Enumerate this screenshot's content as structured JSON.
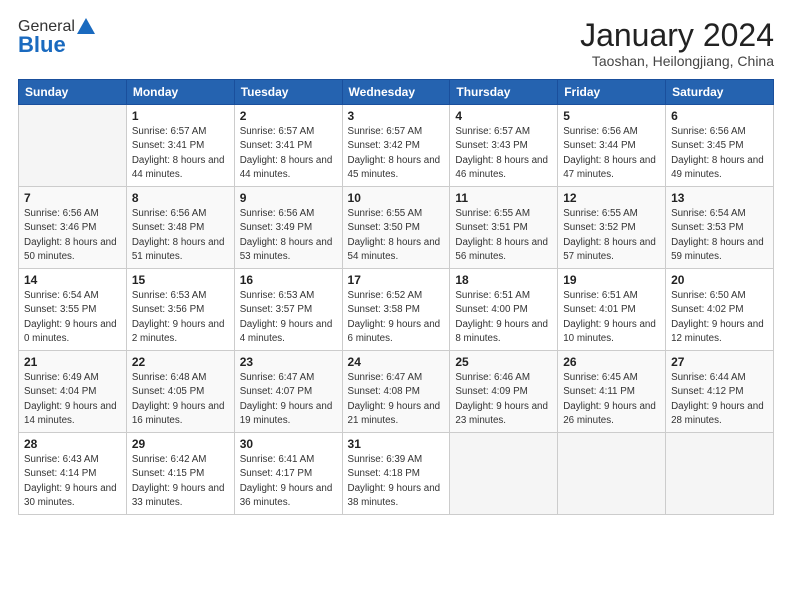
{
  "header": {
    "logo_general": "General",
    "logo_blue": "Blue",
    "month_year": "January 2024",
    "location": "Taoshan, Heilongjiang, China"
  },
  "days_of_week": [
    "Sunday",
    "Monday",
    "Tuesday",
    "Wednesday",
    "Thursday",
    "Friday",
    "Saturday"
  ],
  "weeks": [
    [
      {
        "day": "",
        "empty": true
      },
      {
        "day": "1",
        "sunrise": "6:57 AM",
        "sunset": "3:41 PM",
        "daylight": "8 hours and 44 minutes."
      },
      {
        "day": "2",
        "sunrise": "6:57 AM",
        "sunset": "3:41 PM",
        "daylight": "8 hours and 44 minutes."
      },
      {
        "day": "3",
        "sunrise": "6:57 AM",
        "sunset": "3:42 PM",
        "daylight": "8 hours and 45 minutes."
      },
      {
        "day": "4",
        "sunrise": "6:57 AM",
        "sunset": "3:43 PM",
        "daylight": "8 hours and 46 minutes."
      },
      {
        "day": "5",
        "sunrise": "6:56 AM",
        "sunset": "3:44 PM",
        "daylight": "8 hours and 47 minutes."
      },
      {
        "day": "6",
        "sunrise": "6:56 AM",
        "sunset": "3:45 PM",
        "daylight": "8 hours and 49 minutes."
      }
    ],
    [
      {
        "day": "7",
        "sunrise": "6:56 AM",
        "sunset": "3:46 PM",
        "daylight": "8 hours and 50 minutes."
      },
      {
        "day": "8",
        "sunrise": "6:56 AM",
        "sunset": "3:48 PM",
        "daylight": "8 hours and 51 minutes."
      },
      {
        "day": "9",
        "sunrise": "6:56 AM",
        "sunset": "3:49 PM",
        "daylight": "8 hours and 53 minutes."
      },
      {
        "day": "10",
        "sunrise": "6:55 AM",
        "sunset": "3:50 PM",
        "daylight": "8 hours and 54 minutes."
      },
      {
        "day": "11",
        "sunrise": "6:55 AM",
        "sunset": "3:51 PM",
        "daylight": "8 hours and 56 minutes."
      },
      {
        "day": "12",
        "sunrise": "6:55 AM",
        "sunset": "3:52 PM",
        "daylight": "8 hours and 57 minutes."
      },
      {
        "day": "13",
        "sunrise": "6:54 AM",
        "sunset": "3:53 PM",
        "daylight": "8 hours and 59 minutes."
      }
    ],
    [
      {
        "day": "14",
        "sunrise": "6:54 AM",
        "sunset": "3:55 PM",
        "daylight": "9 hours and 0 minutes."
      },
      {
        "day": "15",
        "sunrise": "6:53 AM",
        "sunset": "3:56 PM",
        "daylight": "9 hours and 2 minutes."
      },
      {
        "day": "16",
        "sunrise": "6:53 AM",
        "sunset": "3:57 PM",
        "daylight": "9 hours and 4 minutes."
      },
      {
        "day": "17",
        "sunrise": "6:52 AM",
        "sunset": "3:58 PM",
        "daylight": "9 hours and 6 minutes."
      },
      {
        "day": "18",
        "sunrise": "6:51 AM",
        "sunset": "4:00 PM",
        "daylight": "9 hours and 8 minutes."
      },
      {
        "day": "19",
        "sunrise": "6:51 AM",
        "sunset": "4:01 PM",
        "daylight": "9 hours and 10 minutes."
      },
      {
        "day": "20",
        "sunrise": "6:50 AM",
        "sunset": "4:02 PM",
        "daylight": "9 hours and 12 minutes."
      }
    ],
    [
      {
        "day": "21",
        "sunrise": "6:49 AM",
        "sunset": "4:04 PM",
        "daylight": "9 hours and 14 minutes."
      },
      {
        "day": "22",
        "sunrise": "6:48 AM",
        "sunset": "4:05 PM",
        "daylight": "9 hours and 16 minutes."
      },
      {
        "day": "23",
        "sunrise": "6:47 AM",
        "sunset": "4:07 PM",
        "daylight": "9 hours and 19 minutes."
      },
      {
        "day": "24",
        "sunrise": "6:47 AM",
        "sunset": "4:08 PM",
        "daylight": "9 hours and 21 minutes."
      },
      {
        "day": "25",
        "sunrise": "6:46 AM",
        "sunset": "4:09 PM",
        "daylight": "9 hours and 23 minutes."
      },
      {
        "day": "26",
        "sunrise": "6:45 AM",
        "sunset": "4:11 PM",
        "daylight": "9 hours and 26 minutes."
      },
      {
        "day": "27",
        "sunrise": "6:44 AM",
        "sunset": "4:12 PM",
        "daylight": "9 hours and 28 minutes."
      }
    ],
    [
      {
        "day": "28",
        "sunrise": "6:43 AM",
        "sunset": "4:14 PM",
        "daylight": "9 hours and 30 minutes."
      },
      {
        "day": "29",
        "sunrise": "6:42 AM",
        "sunset": "4:15 PM",
        "daylight": "9 hours and 33 minutes."
      },
      {
        "day": "30",
        "sunrise": "6:41 AM",
        "sunset": "4:17 PM",
        "daylight": "9 hours and 36 minutes."
      },
      {
        "day": "31",
        "sunrise": "6:39 AM",
        "sunset": "4:18 PM",
        "daylight": "9 hours and 38 minutes."
      },
      {
        "day": "",
        "empty": true
      },
      {
        "day": "",
        "empty": true
      },
      {
        "day": "",
        "empty": true
      }
    ]
  ]
}
